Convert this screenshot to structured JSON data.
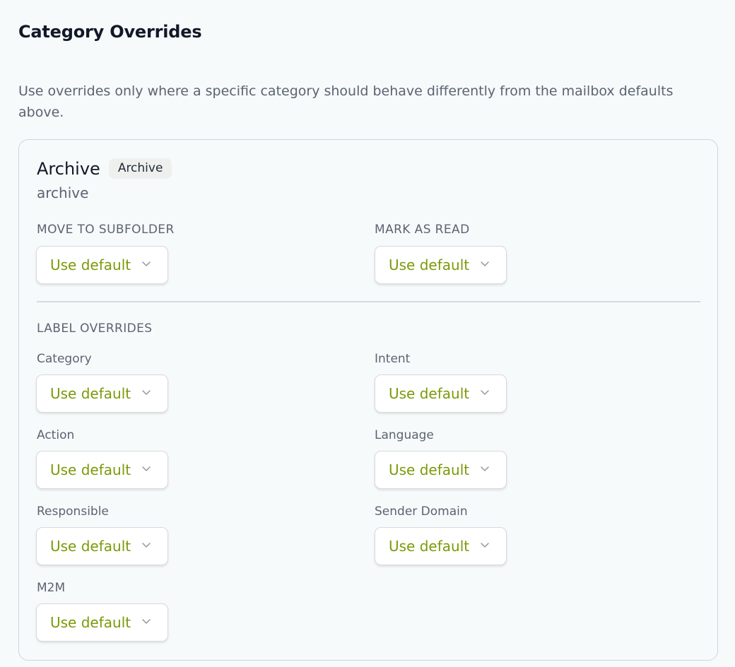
{
  "section": {
    "title": "Category Overrides",
    "description": "Use overrides only where a specific category should behave differently from the mailbox defaults above."
  },
  "card": {
    "name": "Archive",
    "badge": "Archive",
    "key": "archive",
    "move_to_subfolder": {
      "label": "MOVE TO SUBFOLDER",
      "value": "Use default"
    },
    "mark_as_read": {
      "label": "MARK AS READ",
      "value": "Use default"
    },
    "label_overrides_title": "LABEL OVERRIDES",
    "label_overrides": {
      "category": {
        "label": "Category",
        "value": "Use default"
      },
      "intent": {
        "label": "Intent",
        "value": "Use default"
      },
      "action": {
        "label": "Action",
        "value": "Use default"
      },
      "language": {
        "label": "Language",
        "value": "Use default"
      },
      "responsible": {
        "label": "Responsible",
        "value": "Use default"
      },
      "sender_domain": {
        "label": "Sender Domain",
        "value": "Use default"
      },
      "m2m": {
        "label": "M2M",
        "value": "Use default"
      }
    }
  },
  "colors": {
    "accent_value": "#7a9a08",
    "muted_text": "#5b6472",
    "border": "#cfd4da"
  },
  "icons": {
    "select_chevron": "chevron-down-icon"
  }
}
